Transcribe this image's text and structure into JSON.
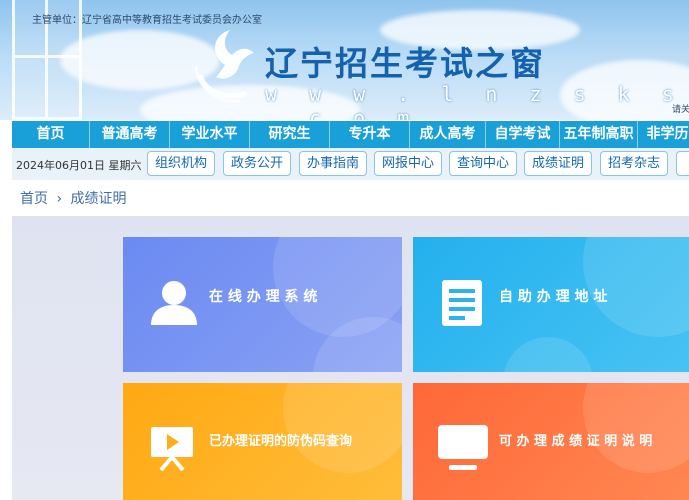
{
  "header": {
    "authority": "主管单位：辽宁省高中等教育招生考试委员会办公室",
    "site_title": "辽宁招生考试之窗",
    "site_url": "w w w . l n z s k s . c o m",
    "right_text": "请关"
  },
  "main_nav": [
    "首页",
    "普通高考",
    "学业水平",
    "研究生",
    "专升本",
    "成人高考",
    "自学考试",
    "五年制高职",
    "非学历"
  ],
  "subbar": {
    "date": "2024年06月01日 星期六",
    "quick_links": [
      "组织机构",
      "政务公开",
      "办事指南",
      "网报中心",
      "查询中心",
      "成绩证明",
      "招考杂志"
    ]
  },
  "breadcrumb": {
    "home": "首页",
    "separator": "›",
    "current": "成绩证明"
  },
  "cards": [
    {
      "label": "在 线 办 理 系 统",
      "icon": "person-icon",
      "color": "#6f8bf0"
    },
    {
      "label": "自 助 办 理 地 址",
      "icon": "document-icon",
      "color": "#2bb6f0"
    },
    {
      "label": "已办理证明的防伪码查询",
      "icon": "presentation-icon",
      "color": "#ffad18"
    },
    {
      "label": "可 办 理 成 绩 证 明 说 明",
      "icon": "monitor-icon",
      "color": "#ff6f3c"
    }
  ]
}
